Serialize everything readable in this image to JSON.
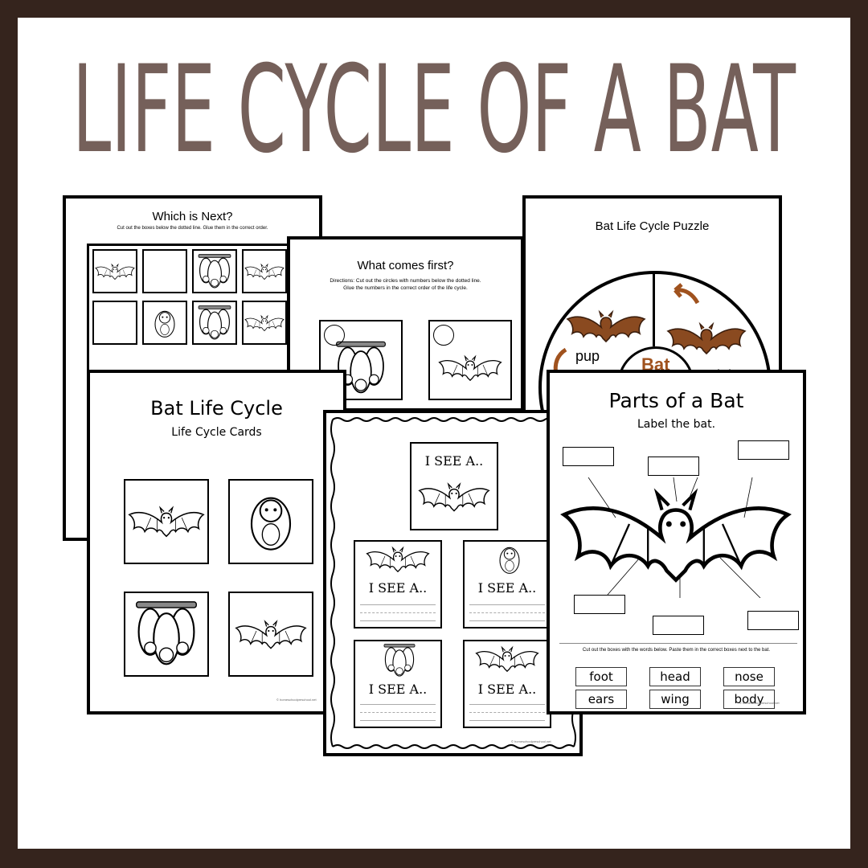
{
  "title": "LIFE CYCLE OF A BAT",
  "colors": {
    "frame": "#35241d",
    "title": "#75605a",
    "accent": "#a0521e"
  },
  "which_next": {
    "title": "Which is Next?",
    "directions": "Cut out the boxes below the dotted line. Glue them in the correct order."
  },
  "what_first": {
    "title": "What comes first?",
    "directions_1": "Directions: Cut out the circles with numbers below the dotted line.",
    "directions_2": "Glue the numbers in the correct order of the life cycle."
  },
  "puzzle": {
    "title": "Bat Life Cycle Puzzle",
    "labels": {
      "pup": "pup",
      "center": "Bat",
      "adult": "adult"
    }
  },
  "cards": {
    "title": "Bat Life Cycle",
    "subtitle": "Life Cycle Cards",
    "watermark": "© homeschoolpreschool.net"
  },
  "i_see": {
    "label": "I SEE A..",
    "watermark": "© homeschoolpreschool.net"
  },
  "parts": {
    "title": "Parts of a Bat",
    "subtitle": "Label the bat.",
    "directions": "Cut out the boxes with the words below. Paste them in the correct boxes next to the bat.",
    "words": [
      "foot",
      "head",
      "nose",
      "ears",
      "wing",
      "body"
    ],
    "watermark": "© homeschoolpreschool.net"
  }
}
